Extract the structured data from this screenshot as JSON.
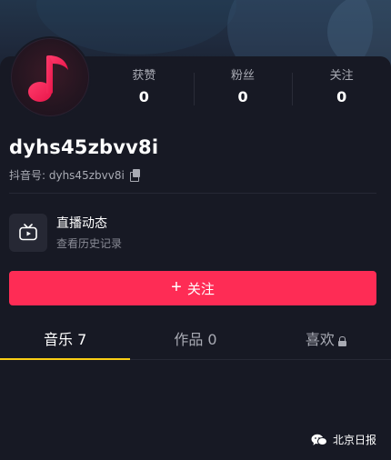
{
  "profile": {
    "username": "dyhs45zbvv8i",
    "douyin_id_label": "抖音号: dyhs45zbvv8i"
  },
  "stats": [
    {
      "label": "获赞",
      "value": "0"
    },
    {
      "label": "粉丝",
      "value": "0"
    },
    {
      "label": "关注",
      "value": "0"
    }
  ],
  "live": {
    "title": "直播动态",
    "subtitle": "查看历史记录"
  },
  "follow_button": {
    "plus": "+",
    "label": "关注"
  },
  "tabs": [
    {
      "label": "音乐 7",
      "active": true
    },
    {
      "label": "作品 0",
      "active": false
    },
    {
      "label": "喜欢",
      "active": false,
      "locked": true
    }
  ],
  "watermark": {
    "text": "北京日报"
  },
  "colors": {
    "accent": "#fe2c55",
    "tab_indicator": "#face15",
    "background": "#161823"
  },
  "icons": {
    "avatar": "music-note-icon",
    "copy": "copy-icon",
    "live": "tv-play-icon",
    "lock": "lock-icon",
    "watermark": "wechat-icon"
  }
}
